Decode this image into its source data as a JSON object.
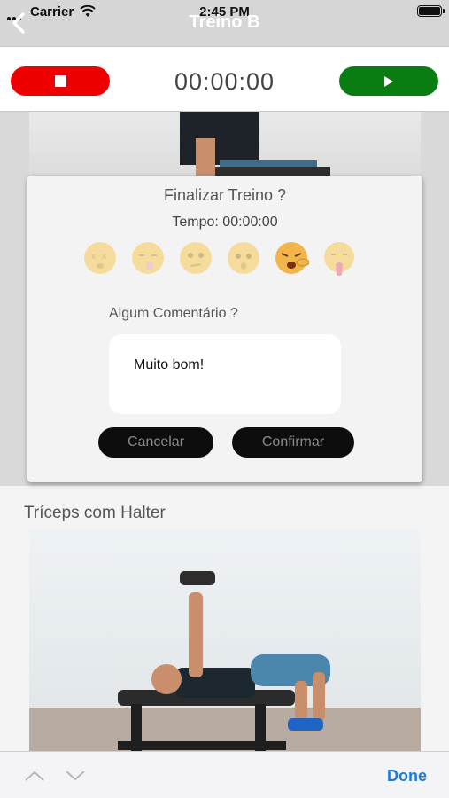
{
  "status_bar": {
    "carrier": "Carrier",
    "time": "2:45 PM"
  },
  "nav": {
    "title": "Treino B",
    "back_icon": "chevron-left-icon"
  },
  "timer_bar": {
    "elapsed": "00:00:00",
    "stop_icon": "stop-icon",
    "play_icon": "play-icon"
  },
  "dialog": {
    "title": "Finalizar Treino ?",
    "time_label": "Tempo: 00:00:00",
    "emojis": [
      "dizzy-face-icon",
      "sleepy-face-icon",
      "thinking-face-icon",
      "fearful-face-icon",
      "tired-face-icon",
      "nauseated-face-icon"
    ],
    "selected_emoji_index": 4,
    "comment_label": "Algum Comentário ?",
    "comment_value": "Muito bom!",
    "cancel_label": "Cancelar",
    "confirm_label": "Confirmar"
  },
  "exercise": {
    "title": "Tríceps com Halter"
  },
  "keyboard_toolbar": {
    "done_label": "Done"
  },
  "colors": {
    "stop": "#ee0000",
    "play": "#0a7d12",
    "done": "#1a7ad6"
  }
}
